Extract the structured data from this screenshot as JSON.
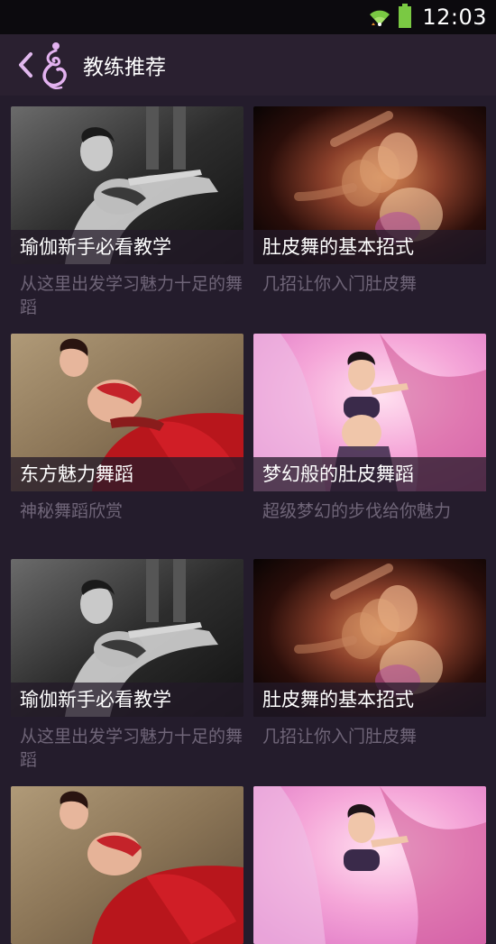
{
  "status_bar": {
    "time": "12:03",
    "icons": [
      "wifi-icon",
      "battery-icon"
    ],
    "accent": "#7ac943"
  },
  "header": {
    "title": "教练推荐",
    "back_icon": "chevron-left-icon",
    "logo_icon": "dancer-logo-icon",
    "logo_color": "#d9a0e6"
  },
  "cards": [
    {
      "title": "瑜伽新手必看教学",
      "description": "从这里出发学习魅力十足的舞蹈",
      "image": "black-white-dancer-photo"
    },
    {
      "title": "肚皮舞的基本招式",
      "description": "几招让你入门肚皮舞",
      "image": "motion-blur-dancer-photo"
    },
    {
      "title": "东方魅力舞蹈",
      "description": "神秘舞蹈欣赏",
      "image": "red-skirt-dancer-photo"
    },
    {
      "title": "梦幻般的肚皮舞蹈",
      "description": "超级梦幻的步伐给你魅力",
      "image": "pink-background-dancer-photo"
    },
    {
      "title": "瑜伽新手必看教学",
      "description": "从这里出发学习魅力十足的舞蹈",
      "image": "black-white-dancer-photo"
    },
    {
      "title": "肚皮舞的基本招式",
      "description": "几招让你入门肚皮舞",
      "image": "motion-blur-dancer-photo"
    },
    {
      "title": "",
      "description": "",
      "image": "red-skirt-dancer-photo"
    },
    {
      "title": "",
      "description": "",
      "image": "pink-background-dancer-photo"
    }
  ],
  "colors": {
    "background": "#241c2c",
    "header": "#2a2030",
    "description_text": "#6f6578"
  }
}
